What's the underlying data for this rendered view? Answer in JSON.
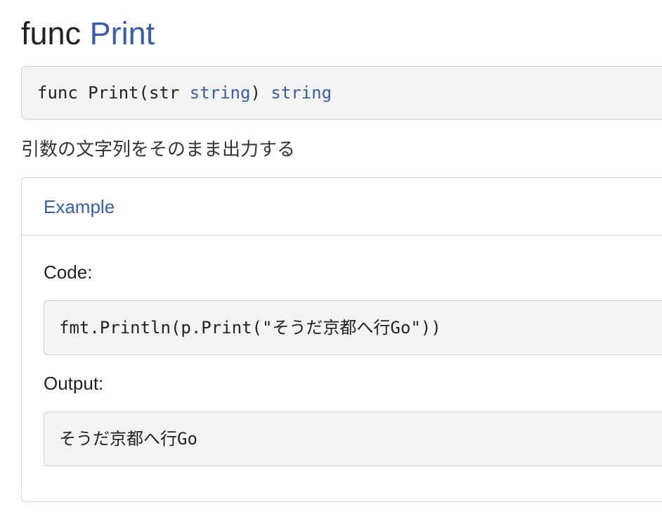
{
  "heading": {
    "keyword": "func",
    "name": "Print"
  },
  "signature": {
    "prefix": "func Print(str ",
    "param_type": "string",
    "close_paren": ") ",
    "return_type": "string"
  },
  "description": "引数の文字列をそのまま出力する",
  "example": {
    "header": "Example",
    "code_label": "Code:",
    "code": "fmt.Println(p.Print(\"そうだ京都へ行Go\"))",
    "output_label": "Output:",
    "output": "そうだ京都へ行Go"
  },
  "colors": {
    "accent": "#375eab",
    "code_bg": "#f3f3f3",
    "border": "#cfcfcf"
  }
}
